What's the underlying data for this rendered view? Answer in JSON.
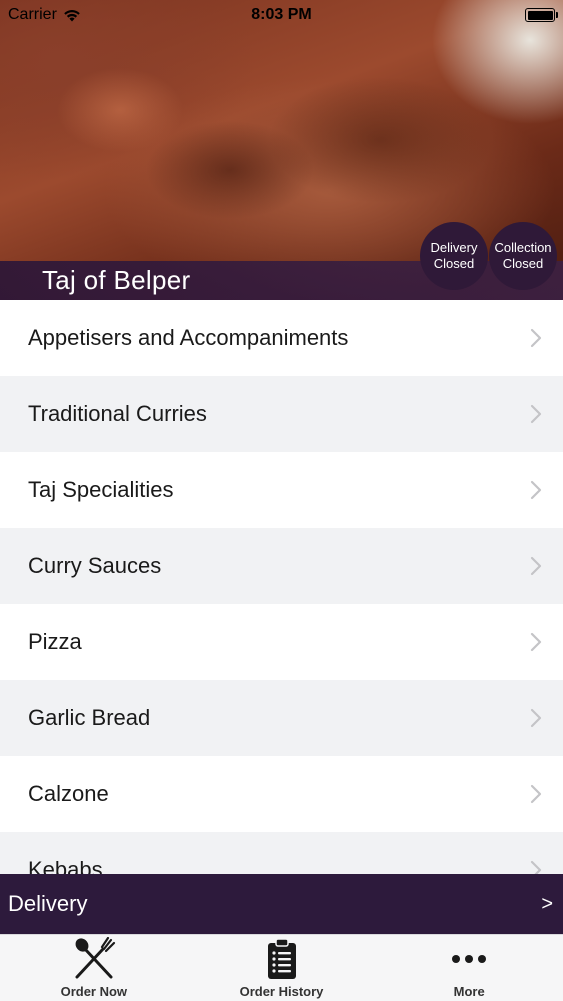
{
  "status_bar": {
    "carrier": "Carrier",
    "time": "8:03 PM"
  },
  "header": {
    "restaurant_name": "Taj of Belper",
    "delivery_badge": {
      "line1": "Delivery",
      "line2": "Closed"
    },
    "collection_badge": {
      "line1": "Collection",
      "line2": "Closed"
    }
  },
  "menu": {
    "categories": [
      "Appetisers and Accompaniments",
      "Traditional Curries",
      "Taj Specialities",
      "Curry Sauces",
      "Pizza",
      "Garlic Bread",
      "Calzone",
      "Kebabs"
    ]
  },
  "order_bar": {
    "mode_label": "Delivery",
    "arrow": ">"
  },
  "tab_bar": {
    "tabs": [
      {
        "label": "Order Now",
        "icon": "fork-knife-icon"
      },
      {
        "label": "Order History",
        "icon": "clipboard-list-icon"
      },
      {
        "label": "More",
        "icon": "more-dots-icon"
      }
    ]
  },
  "colors": {
    "brand_purple": "#2d1a3c",
    "badge_purple": "#2f1938",
    "row_alt": "#f1f2f4"
  }
}
